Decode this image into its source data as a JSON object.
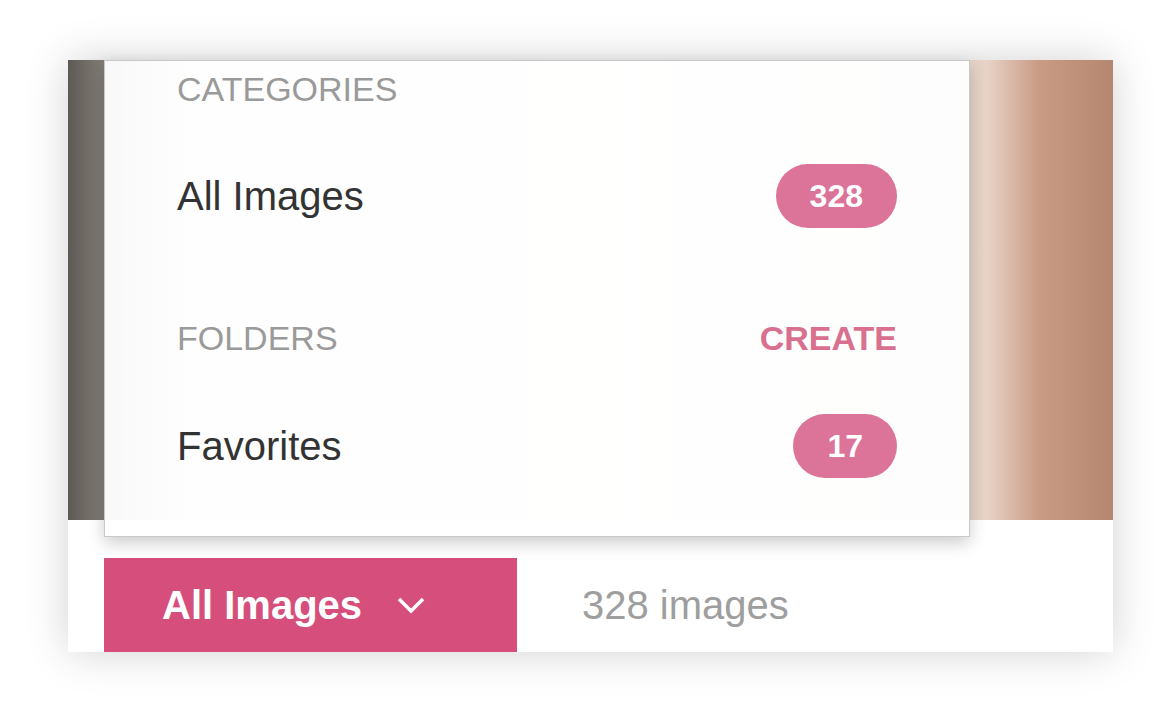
{
  "menu": {
    "categories": {
      "heading": "CATEGORIES",
      "items": [
        {
          "label": "All Images",
          "count": "328"
        }
      ]
    },
    "folders": {
      "heading": "FOLDERS",
      "action": "CREATE",
      "items": [
        {
          "label": "Favorites",
          "count": "17"
        }
      ]
    }
  },
  "dropdown_button": {
    "label": "All Images",
    "expanded": true
  },
  "image_count": "328 images"
}
